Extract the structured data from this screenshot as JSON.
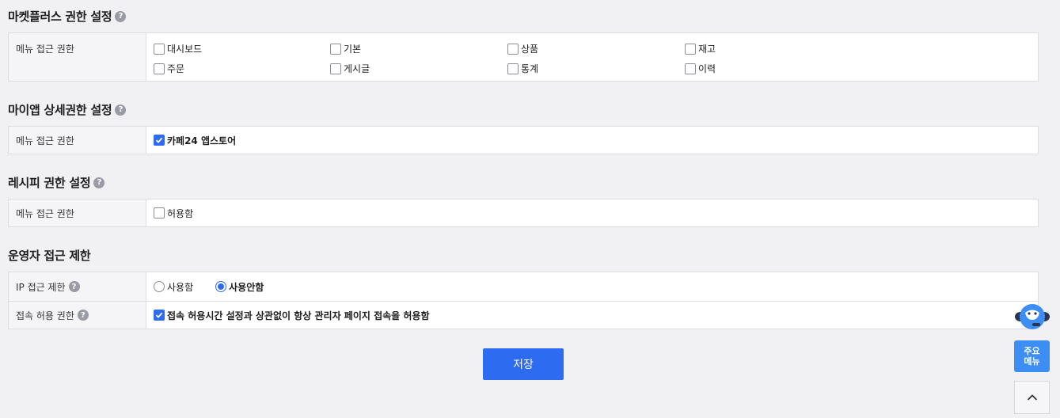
{
  "sections": {
    "marketplace": {
      "title": "마켓플러스 권한 설정",
      "row_label": "메뉴 접근 권한",
      "options": [
        "대시보드",
        "기본",
        "상품",
        "재고",
        "주문",
        "게시글",
        "통계",
        "이력"
      ]
    },
    "myapp": {
      "title": "마이앱 상세권한 설정",
      "row_label": "메뉴 접근 권한",
      "option": "카페24 앱스토어"
    },
    "recipe": {
      "title": "레시피 권한 설정",
      "row_label": "메뉴 접근 권한",
      "option": "허용함"
    },
    "operator": {
      "title": "운영자 접근 제한",
      "ip_label": "IP 접근 제한",
      "ip_use": "사용함",
      "ip_not_use": "사용안함",
      "access_label": "접속 허용 권한",
      "access_option": "접속 허용시간 설정과 상관없이 항상 관리자 페이지 접속을 허용함"
    }
  },
  "help_glyph": "?",
  "save_label": "저장",
  "quick_menu": {
    "line1": "주요",
    "line2": "메뉴"
  },
  "colors": {
    "accent": "#2d6bf0",
    "quick_menu": "#3c8ef5"
  },
  "icons": {
    "help": "help-icon",
    "chatbot": "chatbot-icon",
    "scroll_top": "chevron-up-icon"
  }
}
